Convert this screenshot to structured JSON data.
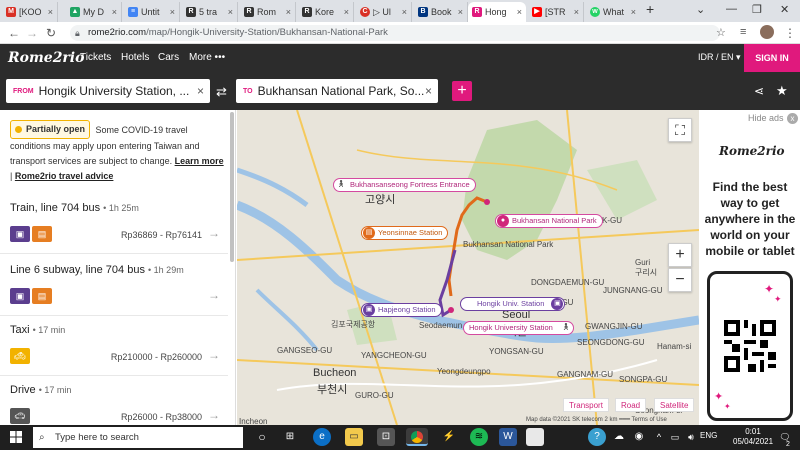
{
  "browser": {
    "tabs": [
      {
        "label": "[KOO",
        "icon": "gmail-icon"
      },
      {
        "label": "My D",
        "icon": "drive-icon"
      },
      {
        "label": "Untit",
        "icon": "docs-icon"
      },
      {
        "label": "5 tra",
        "icon": "rome2rio-icon"
      },
      {
        "label": "Rom",
        "icon": "rome2rio-icon"
      },
      {
        "label": "Kore",
        "icon": "rome2rio-icon"
      },
      {
        "label": "▷ Ul",
        "icon": "red-icon"
      },
      {
        "label": "Book",
        "icon": "booking-icon"
      },
      {
        "label": "Hong",
        "icon": "rome2rio-icon"
      },
      {
        "label": "[STR",
        "icon": "youtube-icon"
      },
      {
        "label": "What",
        "icon": "whatsapp-icon"
      }
    ],
    "new_tab": "+",
    "url_host": "rome2rio.com",
    "url_path": "/map/Hongik-University-Station/Bukhansan-National-Park"
  },
  "site": {
    "logo": "Rome2rio",
    "nav": [
      "Tickets",
      "Hotels",
      "Cars",
      "More •••"
    ],
    "language": "IDR / EN ▾",
    "signin": "SIGN IN"
  },
  "search": {
    "from_tag": "FROM",
    "from_value": "Hongik University Station, ...",
    "to_tag": "TO",
    "to_value": "Bukhansan National Park, So..."
  },
  "notice": {
    "badge": "Partially open",
    "text": "Some COVID-19 travel conditions may apply upon entering Taiwan and transport services are subject to change.",
    "learn_more": "Learn more",
    "sep": "|",
    "advice": "Rome2rio travel advice"
  },
  "routes": [
    {
      "title": "Train, line 704 bus",
      "duration": "1h 25m",
      "price": "Rp36869 - Rp76141",
      "modes": [
        "train",
        "bus"
      ]
    },
    {
      "title": "Line 6 subway, line 704 bus",
      "duration": "1h 29m",
      "price": "",
      "modes": [
        "train",
        "bus"
      ]
    },
    {
      "title": "Taxi",
      "duration": "17 min",
      "price": "Rp210000 - Rp260000",
      "modes": [
        "taxi"
      ]
    },
    {
      "title": "Drive",
      "duration": "17 min",
      "price": "Rp26000 - Rp38000",
      "modes": [
        "car"
      ]
    }
  ],
  "map": {
    "pins": {
      "fortress": "Bukhansanseong Fortress Entrance",
      "park": "Bukhansan National Park",
      "yeonsinnae": "Yeonsinnae Station",
      "hapjeong": "Hapjeong Station",
      "hongik_univ": "Hongik Univ. Station",
      "hongik_university": "Hongik University Station"
    },
    "labels": {
      "goyang": "고양시",
      "seoul": "Seoul",
      "seoul_kr": "서울",
      "bucheon": "Bucheon",
      "bucheon_kr": "부천시",
      "guri": "Guri",
      "guri_kr": "구리시",
      "gwangjin": "GWANGJIN-GU",
      "gimpo": "김포국제공항",
      "seongbuk": "SEONGBUK-GU",
      "jungnang": "JUNGNANG-GU",
      "seongdong": "SEONGDONG-GU",
      "dongdaemun": "DONGDAEMUN-GU",
      "gangseo": "GANGSEO-GU",
      "yangcheon": "YANGCHEON-GU",
      "guro": "GURO-GU",
      "yongsan": "YONGSAN-GU",
      "jung": "JUNG-GU",
      "songpa": "SONGPA-GU",
      "gangnam": "GANGNAM-GU",
      "seodaemun": "Seodaemun",
      "yeongdeungpo": "Yeongdeungpo",
      "incheon": "Incheon",
      "seongnam": "Seongnam-si",
      "hanam": "Hanam-si",
      "bukhansan_np": "Bukhansan National Park"
    },
    "types": [
      "Transport",
      "Road",
      "Satellite"
    ],
    "zoom_in": "+",
    "zoom_out": "−",
    "copyright": "Map data ©2021 SK telecom   2 km ━━━   Terms of Use"
  },
  "ad": {
    "hide": "Hide ads",
    "close": "x",
    "logo": "Rome2rio",
    "text": "Find the best way to get anywhere in the world on your mobile or tablet"
  },
  "taskbar": {
    "search_placeholder": "Type here to search",
    "lang": "ENG",
    "time": "0:01",
    "date": "05/04/2021",
    "badge": "2"
  }
}
